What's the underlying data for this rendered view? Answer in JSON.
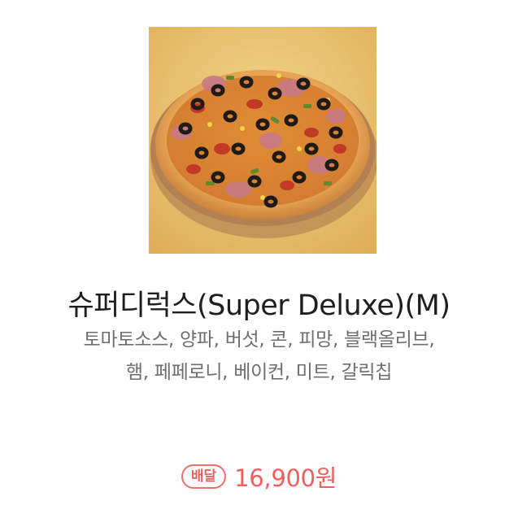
{
  "product": {
    "image_alt": "pizza-image",
    "name": "슈퍼디럭스(Super Deluxe)(M)",
    "description_line1": "토마토소스, 양파, 버섯, 콘, 피망, 블랙올리브,",
    "description_line2": "햄, 페페로니, 베이컨, 미트, 갈릭칩",
    "delivery_badge": "배달",
    "price": "16,900원"
  },
  "colors": {
    "accent": "#ef5f5f",
    "title": "#1e1e1e",
    "description": "#6e6e6e",
    "image_background": "#e9bf6a"
  }
}
